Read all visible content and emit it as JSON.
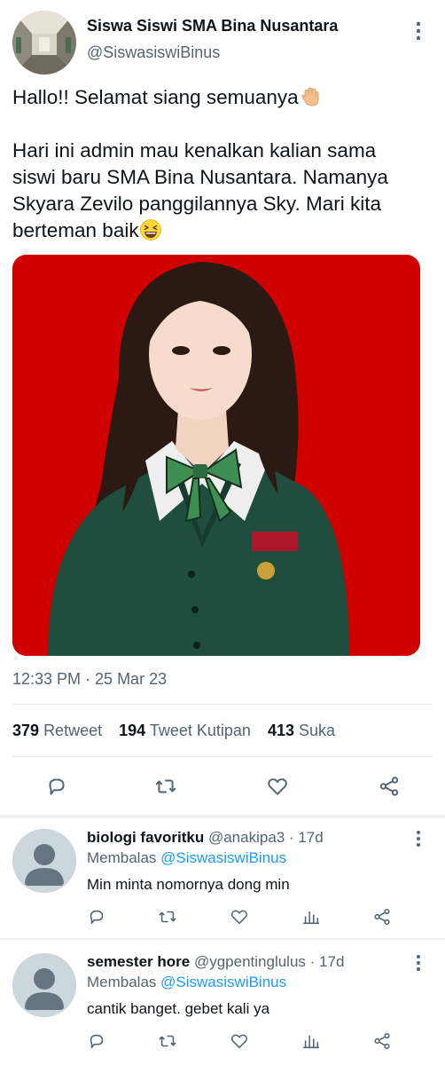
{
  "tweet": {
    "author_name": "Siswa Siswi SMA Bina Nusantara",
    "author_handle": "@SiswasiswiBinus",
    "text_lines": [
      "Hallo!! Selamat siang semuanya",
      "",
      "Hari ini admin mau kenalkan kalian sama",
      "siswi baru SMA Bina Nusantara. Namanya",
      "Skyara Zevilo panggilannya Sky. Mari kita",
      "berteman baik"
    ],
    "emoji_1": "waving-hand-emoji",
    "emoji_2": "grinning-squinting-face-emoji",
    "image_bg_color": "#d10000",
    "timestamp": "12:33 PM · 25 Mar 23",
    "stats": {
      "retweets_count": "379",
      "retweets_label": "Retweet",
      "quotes_count": "194",
      "quotes_label": "Tweet Kutipan",
      "likes_count": "413",
      "likes_label": "Suka"
    },
    "actions": [
      "reply-icon",
      "retweet-icon",
      "like-icon",
      "share-icon"
    ]
  },
  "replies": [
    {
      "name": "biologi favoritku",
      "handle": "@anakipa3",
      "age": "· 17d",
      "replying_label": "Membalas",
      "replying_to": "@SiswasiswiBinus",
      "text": "Min minta nomornya dong min"
    },
    {
      "name": "semester hore",
      "handle": "@ygpentinglulus",
      "age": "· 17d",
      "replying_label": "Membalas",
      "replying_to": "@SiswasiswiBinus",
      "text": "cantik banget. gebet kali ya"
    }
  ],
  "colors": {
    "text_primary": "#0f1419",
    "text_secondary": "#536471",
    "link": "#1d9bf0",
    "divider": "#e6ecf0"
  }
}
